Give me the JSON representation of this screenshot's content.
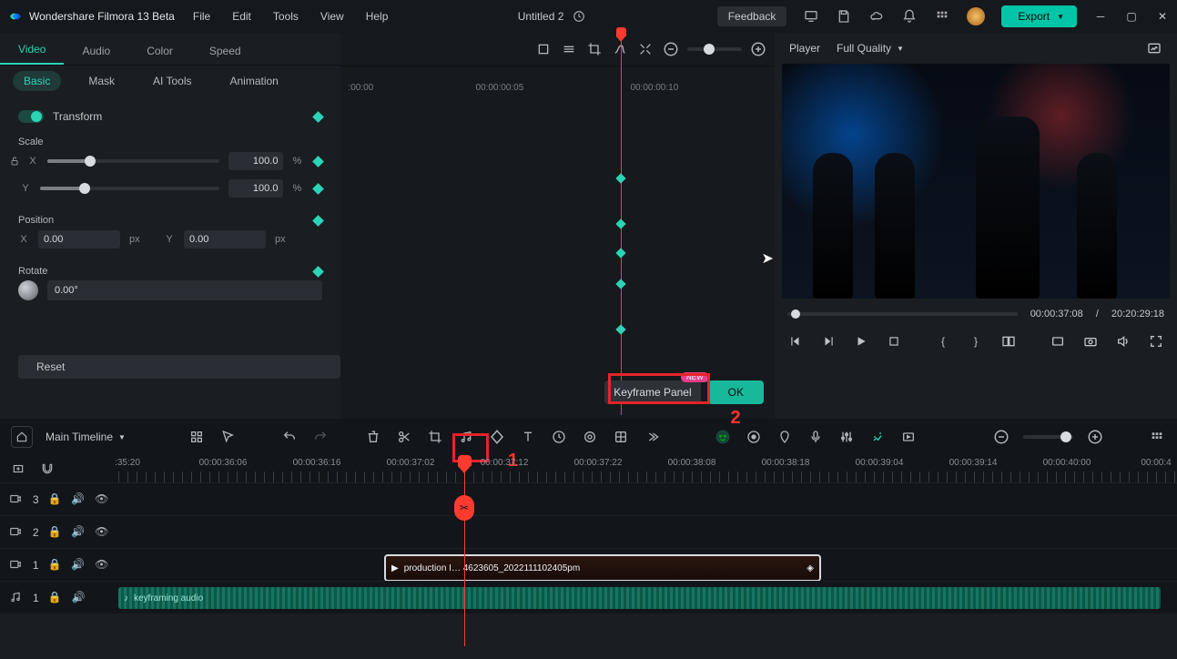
{
  "app": {
    "title": "Wondershare Filmora 13 Beta",
    "document": "Untitled 2"
  },
  "menu": [
    "File",
    "Edit",
    "Tools",
    "View",
    "Help"
  ],
  "titlebar": {
    "feedback": "Feedback",
    "export": "Export"
  },
  "inspector": {
    "tabs": [
      "Video",
      "Audio",
      "Color",
      "Speed"
    ],
    "active_tab": 0,
    "subtabs": [
      "Basic",
      "Mask",
      "AI Tools",
      "Animation"
    ],
    "active_subtab": 0,
    "transform_label": "Transform",
    "scale_label": "Scale",
    "scale": {
      "x": "100.0",
      "y": "100.0",
      "unit": "%"
    },
    "position_label": "Position",
    "position": {
      "x": "0.00",
      "y": "0.00",
      "unit": "px"
    },
    "rotate_label": "Rotate",
    "rotate_value": "0.00°",
    "reset": "Reset",
    "axis_x": "X",
    "axis_y": "Y"
  },
  "kfpanel": {
    "ruler": [
      ":00:00",
      "00:00:00:05",
      "00:00:00:10"
    ],
    "keyframe_panel_btn": "Keyframe Panel",
    "new_badge": "NEW",
    "ok": "OK"
  },
  "player": {
    "label": "Player",
    "quality": "Full Quality",
    "cur": "00:00:37:08",
    "sep": "/",
    "dur": "20:20:29:18"
  },
  "timeline": {
    "main_label": "Main Timeline",
    "ruler": [
      ":35:20",
      "00:00:36:06",
      "00:00:36:16",
      "00:00:37:02",
      "00:00:37:12",
      "00:00:37:22",
      "00:00:38:08",
      "00:00:38:18",
      "00:00:39:04",
      "00:00:39:14",
      "00:00:40:00",
      "00:00:4"
    ],
    "track_heads": [
      {
        "icon": "video-track-icon",
        "num": "3"
      },
      {
        "icon": "video-track-icon",
        "num": "2"
      },
      {
        "icon": "video-track-icon",
        "num": "1"
      },
      {
        "icon": "audio-track-icon",
        "num": "1"
      }
    ],
    "clip_video_label": "production I… 4623605_2022111102405pm",
    "clip_audio_label": "keyframing audio"
  },
  "annotation": {
    "n1": "1",
    "n2": "2"
  },
  "accent": "#2bd4b5",
  "danger": "#ff3b30"
}
